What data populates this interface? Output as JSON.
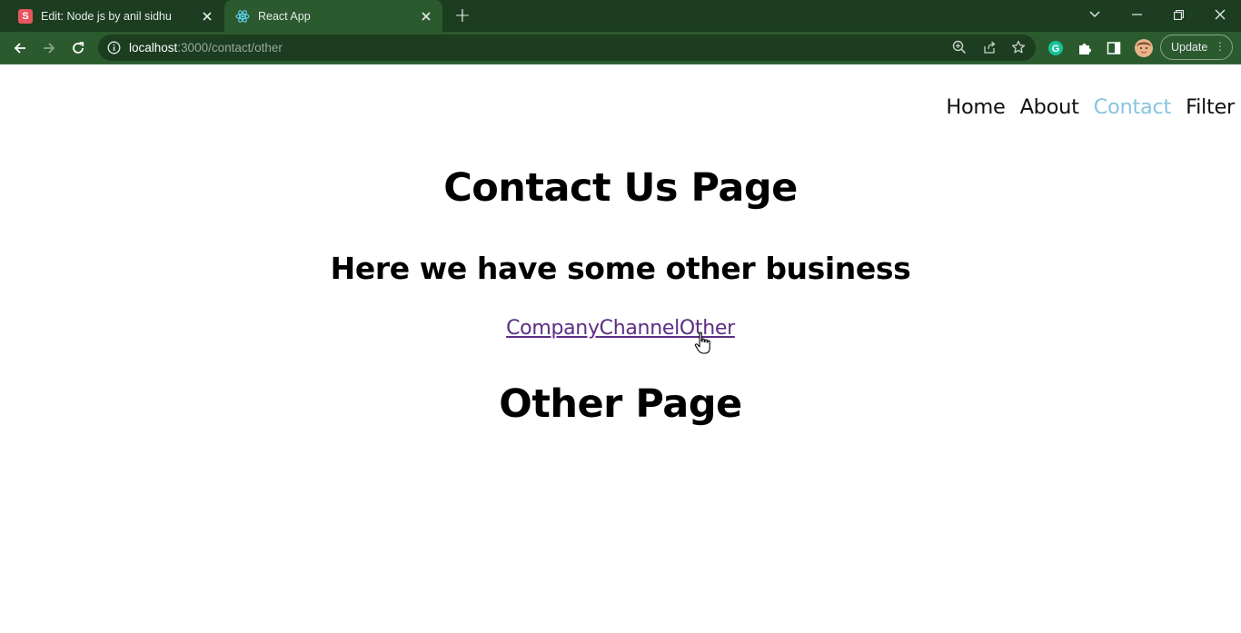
{
  "browser": {
    "tabs": [
      {
        "title": "Edit: Node js by anil sidhu",
        "favicon": "S",
        "favicon_color": "#e9555d"
      },
      {
        "title": "React App",
        "favicon": "react-icon"
      }
    ],
    "new_tab_label": "+",
    "url": {
      "host": "localhost",
      "path": ":3000/contact/other"
    },
    "update_label": "Update",
    "theme_frame": "#1c3d20",
    "theme_toolbar": "#2b5a2f"
  },
  "page": {
    "nav": [
      "Home",
      "About",
      "Contact",
      "Filter"
    ],
    "nav_active": "Contact",
    "nav_active_color": "#87c5e0",
    "title": "Contact Us Page",
    "subtitle": "Here we have some other business",
    "links": [
      "Company",
      "Channel",
      "Other"
    ],
    "link_color": "#5b2e84",
    "section_title": "Other Page"
  }
}
